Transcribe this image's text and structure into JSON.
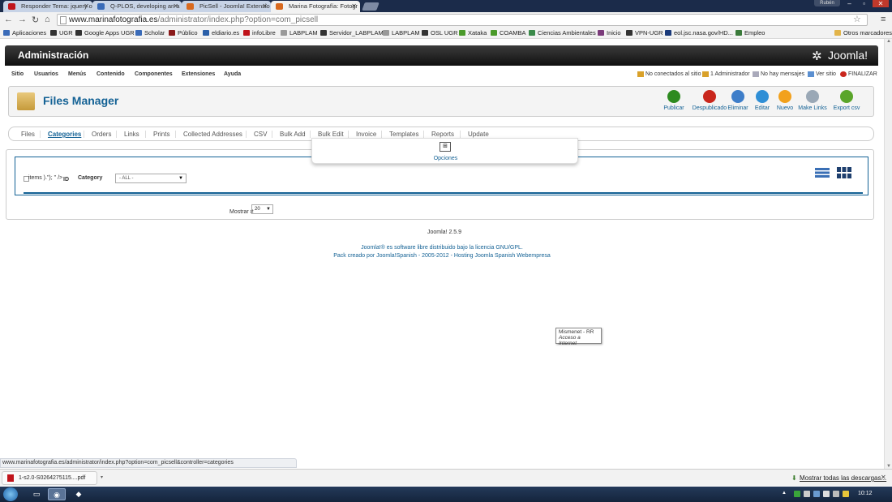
{
  "browser": {
    "tabs": [
      {
        "label": "Responder Tema: jquery o",
        "color": "#c0141b"
      },
      {
        "label": "Q-PLOS, developing an a",
        "color": "#3a6bb8"
      },
      {
        "label": "PicSell - Joomla! Extensio",
        "color": "#d96a1f"
      },
      {
        "label": "Marina Fotografía: Fotogr",
        "color": "#d96a1f"
      }
    ],
    "user": "Rubén",
    "url_host": "www.marinafotografia.es",
    "url_path": "/administrator/index.php?option=com_picsell",
    "bookmarks": [
      {
        "label": "Aplicaciones",
        "color": "#3a6bb8"
      },
      {
        "label": "UGR",
        "color": "#333333"
      },
      {
        "label": "Google Apps UGR",
        "color": "#333333"
      },
      {
        "label": "Scholar",
        "color": "#3a6bb8"
      },
      {
        "label": "Público",
        "color": "#8a1a1a"
      },
      {
        "label": "eldiario.es",
        "color": "#2a5fa8"
      },
      {
        "label": "infoLibre",
        "color": "#c0141b"
      },
      {
        "label": "LABPLAM",
        "color": "#999999"
      },
      {
        "label": "Servidor_LABPLAM",
        "color": "#333333"
      },
      {
        "label": "LABPLAM",
        "color": "#999999"
      },
      {
        "label": "OSL UGR",
        "color": "#333333"
      },
      {
        "label": "Xataka",
        "color": "#4a9a2a"
      },
      {
        "label": "COAMBA",
        "color": "#4a9a2a"
      },
      {
        "label": "Ciencias Ambientales",
        "color": "#3a8a4a"
      },
      {
        "label": "Inicio",
        "color": "#7a3a7a"
      },
      {
        "label": "VPN-UGR",
        "color": "#333333"
      },
      {
        "label": "eol.jsc.nasa.gov/HD...",
        "color": "#1a3a7a"
      },
      {
        "label": "Empleo",
        "color": "#3a7a3a"
      }
    ],
    "other_bookmarks": "Otros marcadores"
  },
  "admin": {
    "title": "Administración",
    "logo_text": "Joomla!",
    "menu": [
      "Sitio",
      "Usuarios",
      "Menús",
      "Contenido",
      "Componentes",
      "Extensiones",
      "Ayuda"
    ],
    "status": {
      "not_connected": "No conectados al sitio",
      "admins": "1 Administrador",
      "messages": "No hay mensajes",
      "view_site": "Ver sitio",
      "logout": "FINALIZAR"
    },
    "page_title": "Files Manager",
    "toolbar": [
      {
        "label": "Publicar",
        "color": "#2d8a1f"
      },
      {
        "label": "Despublicado",
        "color": "#c9261c"
      },
      {
        "label": "Eliminar",
        "color": "#3e7ec9"
      },
      {
        "label": "Editar",
        "color": "#2f8fd6"
      },
      {
        "label": "Nuevo",
        "color": "#f2a11c"
      },
      {
        "label": "Make Links",
        "color": "#9aa8b6"
      },
      {
        "label": "Export csv",
        "color": "#5aa52a"
      }
    ],
    "submenu": [
      "Files",
      "Categories",
      "Orders",
      "Links",
      "Prints",
      "Collected Addresses",
      "CSV",
      "Bulk Add",
      "Bulk Edit",
      "Invoice",
      "Templates",
      "Reports",
      "Update"
    ],
    "submenu_active": "Categories",
    "dropdown_option": "Opciones",
    "filter": {
      "items_text": "items ).\"); \" /> ",
      "id_label": "ID",
      "category_label": "Category",
      "category_value": "- ALL -"
    },
    "limit_label": "Mostrar #",
    "limit_value": "20",
    "version": "Joomla! 2.5.9",
    "footer_line1": "Joomla!® es software libre distribuido bajo la licencia GNU/GPL.",
    "footer_line2": "Pack creado por Joomla!Spanish - 2005-2012 - Hosting Joomla Spanish Webempresa"
  },
  "tooltip": {
    "line1": "Mismenet - RR",
    "line2": "Acceso a Internet"
  },
  "status_url": "www.marinafotografia.es/administrator/index.php?option=com_picsell&controller=categories",
  "download": {
    "file": "1-s2.0-S0264275115....pdf",
    "show_all": "Mostrar todas las descargas..."
  },
  "clock": "10:12"
}
